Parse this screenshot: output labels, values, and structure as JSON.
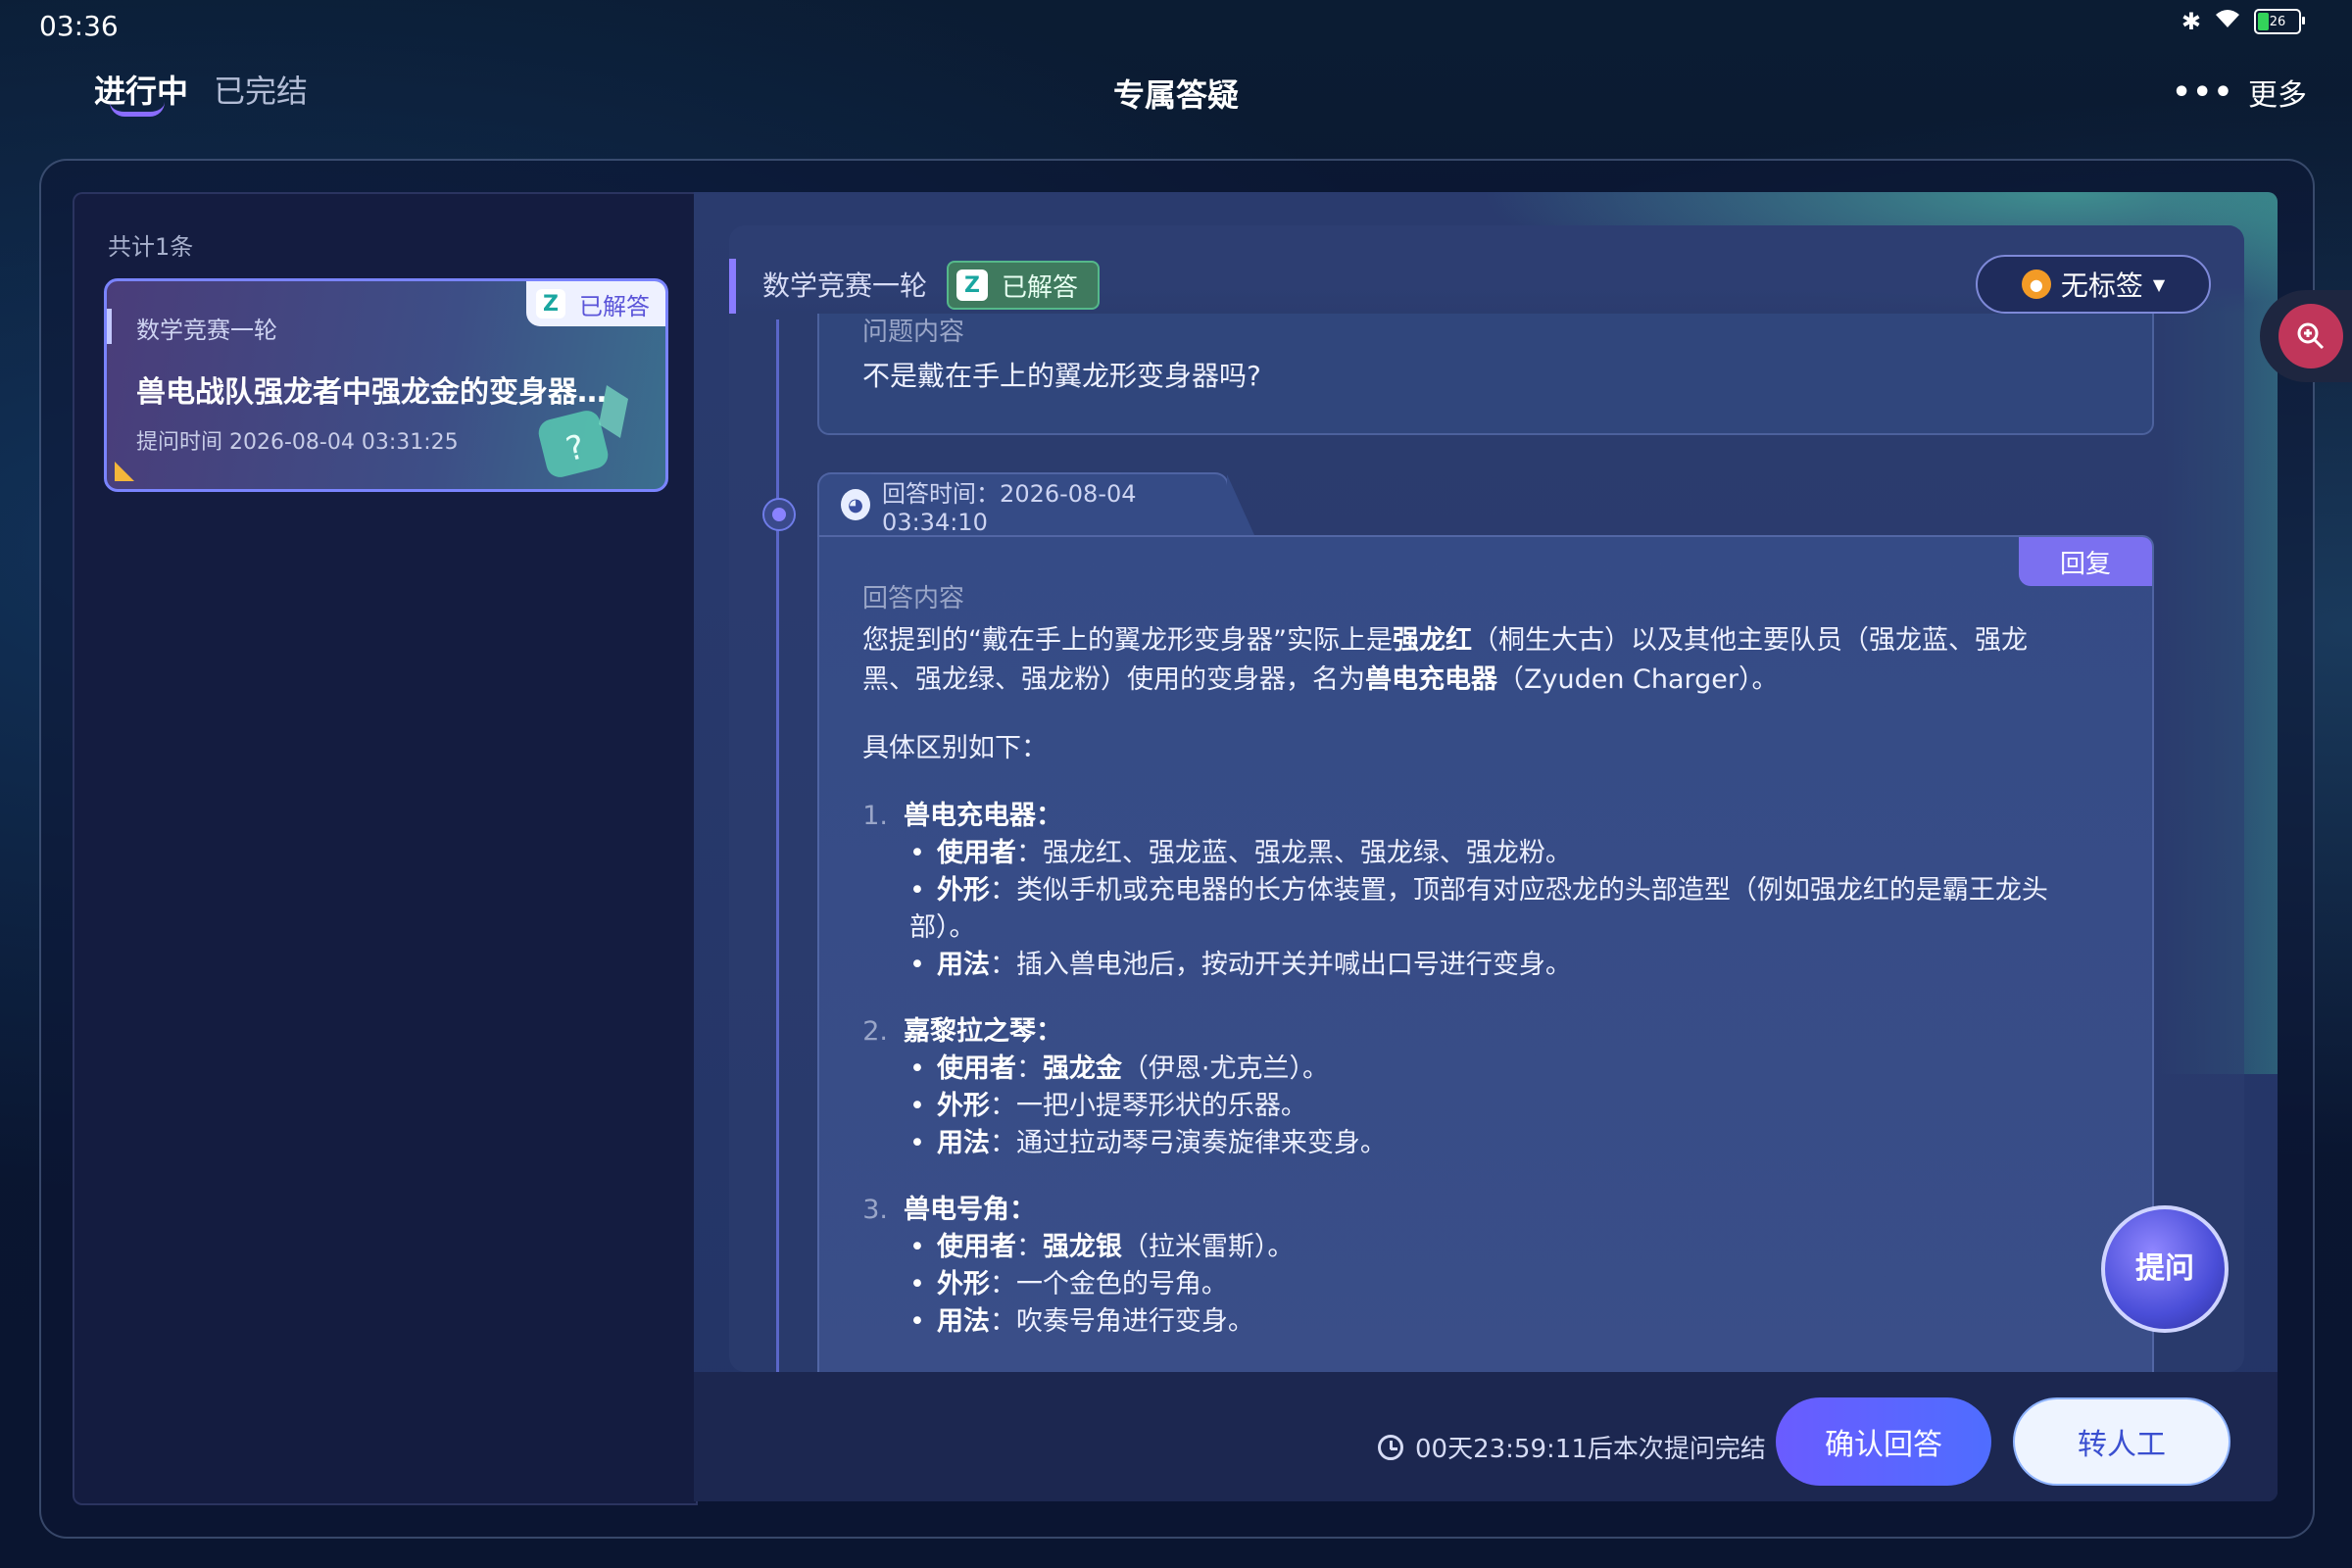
{
  "status_bar": {
    "time": "03:36",
    "battery": "26"
  },
  "header": {
    "tabs": [
      {
        "label": "进行中",
        "active": true
      },
      {
        "label": "已完结",
        "active": false
      }
    ],
    "title": "专属答疑",
    "more_label": "更多"
  },
  "list": {
    "count": "共计1条",
    "items": [
      {
        "category": "数学竞赛一轮",
        "title": "兽电战队强龙者中强龙金的变身器是…",
        "time": "提问时间 2026-08-04 03:31:25",
        "status": "已解答"
      }
    ]
  },
  "detail": {
    "category": "数学竞赛一轮",
    "status": "已解答",
    "tag_dropdown": "无标签",
    "question_label": "问题内容",
    "question_text": "不是戴在手上的翼龙形变身器吗?",
    "answer_time": "回答时间：2026-08-04 03:34:10",
    "reply_label": "回复",
    "answer_label": "回答内容",
    "answer": {
      "intro_1": "您提到的“戴在手上的翼龙形变身器”实际上是",
      "intro_b1": "强龙红",
      "intro_2": "（桐生大古）以及其他主要队员（强龙蓝、强龙黑、强龙绿、强龙粉）使用的变身器，名为",
      "intro_b2": "兽电充电器",
      "intro_3": "（Zyuden Charger）。",
      "diff_intro": "具体区别如下：",
      "sections": [
        {
          "num": "1.",
          "title": "兽电充电器：",
          "bullets": [
            {
              "k": "使用者",
              "sep": "：",
              "b": "",
              "v": "强龙红、强龙蓝、强龙黑、强龙绿、强龙粉。"
            },
            {
              "k": "外形",
              "sep": "：",
              "b": "",
              "v": "类似手机或充电器的长方体装置，顶部有对应恐龙的头部造型（例如强龙红的是霸王龙头部）。"
            },
            {
              "k": "用法",
              "sep": "：",
              "b": "",
              "v": "插入兽电池后，按动开关并喊出口号进行变身。"
            }
          ]
        },
        {
          "num": "2.",
          "title": "嘉黎拉之琴：",
          "bullets": [
            {
              "k": "使用者",
              "sep": "：",
              "b": "强龙金",
              "v": "（伊恩·尤克兰）。"
            },
            {
              "k": "外形",
              "sep": "：",
              "b": "",
              "v": "一把小提琴形状的乐器。"
            },
            {
              "k": "用法",
              "sep": "：",
              "b": "",
              "v": "通过拉动琴弓演奏旋律来变身。"
            }
          ]
        },
        {
          "num": "3.",
          "title": "兽电号角：",
          "bullets": [
            {
              "k": "使用者",
              "sep": "：",
              "b": "强龙银",
              "v": "（拉米雷斯）。"
            },
            {
              "k": "外形",
              "sep": "：",
              "b": "",
              "v": "一个金色的号角。"
            },
            {
              "k": "用法",
              "sep": "：",
              "b": "",
              "v": "吹奏号角进行变身。"
            }
          ]
        }
      ]
    },
    "ask_fab": "提问"
  },
  "footer": {
    "countdown": "00天23:59:11后本次提问完结",
    "confirm_label": "确认回答",
    "human_label": "转人工"
  },
  "colors": {
    "accent": "#6a5cff",
    "answered_green": "#3f7a5e",
    "zoom_red": "#c0365a"
  }
}
